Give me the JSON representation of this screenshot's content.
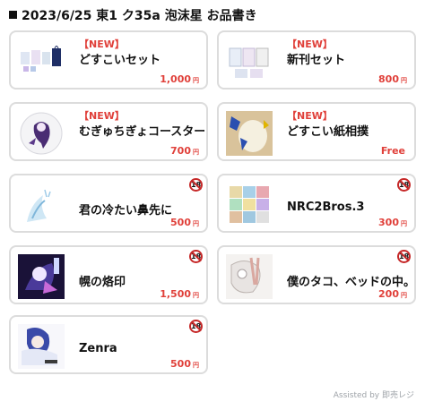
{
  "header": {
    "title": "2023/6/25 東1 ク35a 泡沫星 お品書き"
  },
  "items": [
    {
      "badge": "【NEW】",
      "name": "どすこいセット",
      "price": "1,000",
      "currency": "円",
      "r18": false
    },
    {
      "badge": "【NEW】",
      "name": "新刊セット",
      "price": "800",
      "currency": "円",
      "r18": false
    },
    {
      "badge": "【NEW】",
      "name": "むぎゅちぎょコースター",
      "price": "700",
      "currency": "円",
      "r18": false
    },
    {
      "badge": "【NEW】",
      "name": "どすこい紙相撲",
      "price": "Free",
      "currency": "",
      "r18": false
    },
    {
      "badge": "",
      "name": "君の冷たい鼻先に",
      "price": "500",
      "currency": "円",
      "r18": true,
      "r18_label": "18"
    },
    {
      "badge": "",
      "name": "NRC2Bros.3",
      "price": "300",
      "currency": "円",
      "r18": true,
      "r18_label": "18"
    },
    {
      "badge": "",
      "name": "幌の烙印",
      "price": "1,500",
      "currency": "円",
      "r18": true,
      "r18_label": "18"
    },
    {
      "badge": "",
      "name": "僕のタコ、ベッドの中。",
      "price": "200",
      "currency": "円",
      "r18": true,
      "r18_label": "18"
    },
    {
      "badge": "",
      "name": "Zenra",
      "price": "500",
      "currency": "円",
      "r18": true,
      "r18_label": "18"
    }
  ],
  "footer": {
    "text": "Assisted by 即売レジ"
  }
}
